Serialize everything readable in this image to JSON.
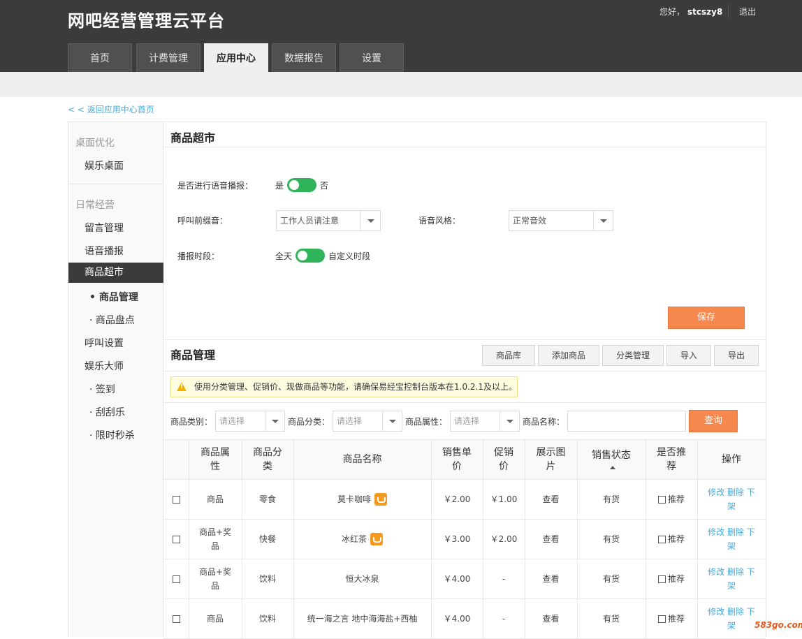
{
  "app": {
    "title": "网吧经营管理云平台",
    "greeting": "您好，",
    "username": "stcszy8",
    "logout": "退出"
  },
  "nav": {
    "tabs": [
      "首页",
      "计费管理",
      "应用中心",
      "数据报告",
      "设置"
    ]
  },
  "back_link": "< < 返回应用中心首页",
  "sidebar": {
    "group1": "桌面优化",
    "desktop": "娱乐桌面",
    "group2": "日常经营",
    "items": [
      "留言管理",
      "语音播报",
      "商品超市"
    ],
    "sub_items": [
      "• 商品管理",
      "· 商品盘点"
    ],
    "items2": [
      "呼叫设置",
      "娱乐大师"
    ],
    "sub_items2": [
      "· 签到",
      "· 刮刮乐",
      "· 限时秒杀"
    ]
  },
  "settings": {
    "title": "商品超市",
    "voice_label": "是否进行语音播报：",
    "yes": "是",
    "no": "否",
    "prefix_label": "呼叫前缀音：",
    "prefix_value": "工作人员请注意",
    "style_label": "语音风格：",
    "style_value": "正常音效",
    "period_label": "播报时段：",
    "all_day": "全天",
    "custom": "自定义时段",
    "save": "保存"
  },
  "goods": {
    "title": "商品管理",
    "buttons": [
      "商品库",
      "添加商品",
      "分类管理",
      "导入",
      "导出"
    ],
    "notice": "使用分类管理、促销价、现做商品等功能，请确保易经宝控制台版本在1.0.2.1及以上。",
    "filters": {
      "category_label": "商品类别：",
      "class_label": "商品分类：",
      "attr_label": "商品属性：",
      "name_label": "商品名称：",
      "placeholder": "请选择"
    },
    "query": "查询",
    "headers": [
      "商品属\n性",
      "商品分\n类",
      "商品名称",
      "销售单\n价",
      "促销\n价",
      "展示图\n片",
      "销售状态",
      "是否推\n荐",
      "操作"
    ],
    "rows": [
      {
        "attr": "商品",
        "class": "零食",
        "name": "莫卡咖啡",
        "price": "￥2.00",
        "promo": "￥1.00",
        "img": "查看",
        "status": "有货",
        "rec": "推荐",
        "ops": "修改 删除 下\n架"
      },
      {
        "attr": "商品+奖\n品",
        "class": "快餐",
        "name": "冰红茶",
        "price": "￥3.00",
        "promo": "￥2.00",
        "img": "查看",
        "status": "有货",
        "rec": "推荐",
        "ops": "修改 删除 下\n架"
      },
      {
        "attr": "商品+奖\n品",
        "class": "饮料",
        "name": "恒大冰泉",
        "price": "￥4.00",
        "promo": "-",
        "img": "查看",
        "status": "有货",
        "rec": "推荐",
        "ops": "修改 删除 下\n架"
      },
      {
        "attr": "商品",
        "class": "饮料",
        "name": "统一海之言 地中海海盐+西柚",
        "price": "￥4.00",
        "promo": "-",
        "img": "查看",
        "status": "有货",
        "rec": "推荐",
        "ops": "修改 删除 下\n架"
      }
    ]
  },
  "watermark": "583go.com",
  "colors": {
    "header": "#3b3b3b",
    "accent": "#f6874d",
    "toggle": "#2fb45a",
    "link": "#4aa9d6"
  }
}
